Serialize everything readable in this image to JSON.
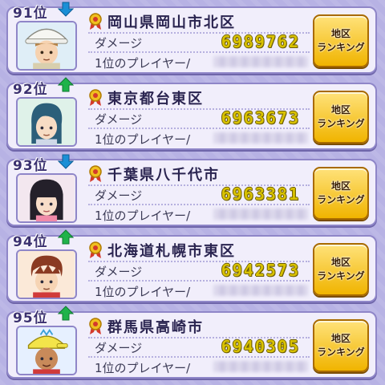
{
  "entries": [
    {
      "rank": "91位",
      "trend": "down",
      "region": "岡山県岡山市北区",
      "damage_label": "ダメージ",
      "damage": "6989762",
      "player_label": "1位のプレイヤー/",
      "button": "地区\nランキング",
      "avatar": "avatar-white-hat"
    },
    {
      "rank": "92位",
      "trend": "up",
      "region": "東京都台東区",
      "damage_label": "ダメージ",
      "damage": "6963673",
      "player_label": "1位のプレイヤー/",
      "button": "地区\nランキング",
      "avatar": "avatar-blue-hair"
    },
    {
      "rank": "93位",
      "trend": "down",
      "region": "千葉県八千代市",
      "damage_label": "ダメージ",
      "damage": "6963381",
      "player_label": "1位のプレイヤー/",
      "button": "地区\nランキング",
      "avatar": "avatar-black-hair"
    },
    {
      "rank": "94位",
      "trend": "up",
      "region": "北海道札幌市東区",
      "damage_label": "ダメージ",
      "damage": "6942573",
      "player_label": "1位のプレイヤー/",
      "button": "地区\nランキング",
      "avatar": "avatar-brown-hair"
    },
    {
      "rank": "95位",
      "trend": "up",
      "region": "群馬県高崎市",
      "damage_label": "ダメージ",
      "damage": "6940305",
      "player_label": "1位のプレイヤー/",
      "button": "地区\nランキング",
      "avatar": "avatar-yellow-cap"
    }
  ],
  "colors": {
    "up": "#1fb34a",
    "down": "#1a8fd6",
    "damage": "#d9c200",
    "button": "#f0b400"
  }
}
